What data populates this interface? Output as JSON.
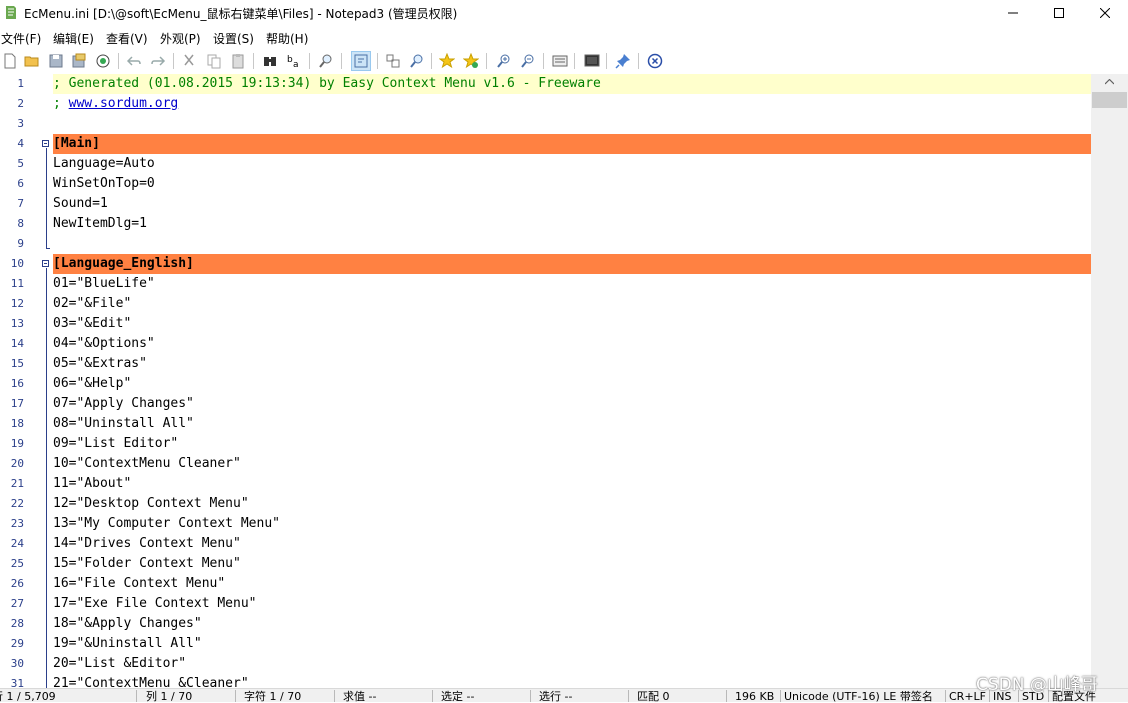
{
  "window": {
    "title": "EcMenu.ini [D:\\@soft\\EcMenu_鼠标右键菜单\\Files] - Notepad3  (管理员权限)",
    "minimize_icon": "minimize-icon",
    "maximize_icon": "maximize-icon",
    "close_icon": "close-icon"
  },
  "menu": [
    "文件(F)",
    "编辑(E)",
    "查看(V)",
    "外观(P)",
    "设置(S)",
    "帮助(H)"
  ],
  "toolbar_icons": [
    "new-file-icon",
    "open-folder-icon",
    "save-icon",
    "save-as-icon",
    "browse-icon",
    "undo-icon",
    "redo-icon",
    "cut-icon",
    "copy-icon",
    "paste-icon",
    "find-icon",
    "replace-icon",
    "zoom-search-icon",
    "word-wrap-icon",
    "fold-icon",
    "find-in-files-icon",
    "favorite-icon",
    "add-favorite-icon",
    "zoom-in-icon",
    "zoom-out-icon",
    "scheme-icon",
    "customize-icon",
    "pin-icon",
    "exit-icon"
  ],
  "colors": {
    "section_highlight": "#ff8142",
    "current_line": "#ffffcc",
    "comment": "#008000",
    "line_number": "#2b3f8a",
    "link": "#0000cc"
  },
  "lines": [
    {
      "n": "1",
      "text": "; Generated (01.08.2015 19:13:34) by Easy Context Menu v1.6 - Freeware",
      "type": "comment"
    },
    {
      "n": "2",
      "text": "; ",
      "link": "www.sordum.org",
      "type": "comment-link"
    },
    {
      "n": "3",
      "text": "",
      "type": "plain"
    },
    {
      "n": "4",
      "text": "[Main]",
      "type": "section"
    },
    {
      "n": "5",
      "text": "Language=Auto",
      "type": "plain"
    },
    {
      "n": "6",
      "text": "WinSetOnTop=0",
      "type": "plain"
    },
    {
      "n": "7",
      "text": "Sound=1",
      "type": "plain"
    },
    {
      "n": "8",
      "text": "NewItemDlg=1",
      "type": "plain"
    },
    {
      "n": "9",
      "text": "",
      "type": "plain"
    },
    {
      "n": "10",
      "text": "[Language_English]",
      "type": "section"
    },
    {
      "n": "11",
      "text": "01=\"BlueLife\"",
      "type": "plain"
    },
    {
      "n": "12",
      "text": "02=\"&File\"",
      "type": "plain"
    },
    {
      "n": "13",
      "text": "03=\"&Edit\"",
      "type": "plain"
    },
    {
      "n": "14",
      "text": "04=\"&Options\"",
      "type": "plain"
    },
    {
      "n": "15",
      "text": "05=\"&Extras\"",
      "type": "plain"
    },
    {
      "n": "16",
      "text": "06=\"&Help\"",
      "type": "plain"
    },
    {
      "n": "17",
      "text": "07=\"Apply Changes\"",
      "type": "plain"
    },
    {
      "n": "18",
      "text": "08=\"Uninstall All\"",
      "type": "plain"
    },
    {
      "n": "19",
      "text": "09=\"List Editor\"",
      "type": "plain"
    },
    {
      "n": "20",
      "text": "10=\"ContextMenu Cleaner\"",
      "type": "plain"
    },
    {
      "n": "21",
      "text": "11=\"About\"",
      "type": "plain"
    },
    {
      "n": "22",
      "text": "12=\"Desktop Context Menu\"",
      "type": "plain"
    },
    {
      "n": "23",
      "text": "13=\"My Computer Context Menu\"",
      "type": "plain"
    },
    {
      "n": "24",
      "text": "14=\"Drives Context Menu\"",
      "type": "plain"
    },
    {
      "n": "25",
      "text": "15=\"Folder Context Menu\"",
      "type": "plain"
    },
    {
      "n": "26",
      "text": "16=\"File Context Menu\"",
      "type": "plain"
    },
    {
      "n": "27",
      "text": "17=\"Exe File Context Menu\"",
      "type": "plain"
    },
    {
      "n": "28",
      "text": "18=\"&Apply Changes\"",
      "type": "plain"
    },
    {
      "n": "29",
      "text": "19=\"&Uninstall All\"",
      "type": "plain"
    },
    {
      "n": "30",
      "text": "20=\"List &Editor\"",
      "type": "plain"
    },
    {
      "n": "31",
      "text": "21=\"ContextMenu &Cleaner\"",
      "type": "plain"
    }
  ],
  "status": [
    "行 1 / 5,709",
    "列 1 / 70",
    "字符 1 / 70",
    "求值 --",
    "选定 --",
    "选行 --",
    "匹配 0",
    "196 KB",
    "Unicode (UTF-16) LE 带签名",
    "CR+LF",
    "INS",
    "STD",
    "配置文件"
  ],
  "watermark": "CSDN @山峰哥"
}
